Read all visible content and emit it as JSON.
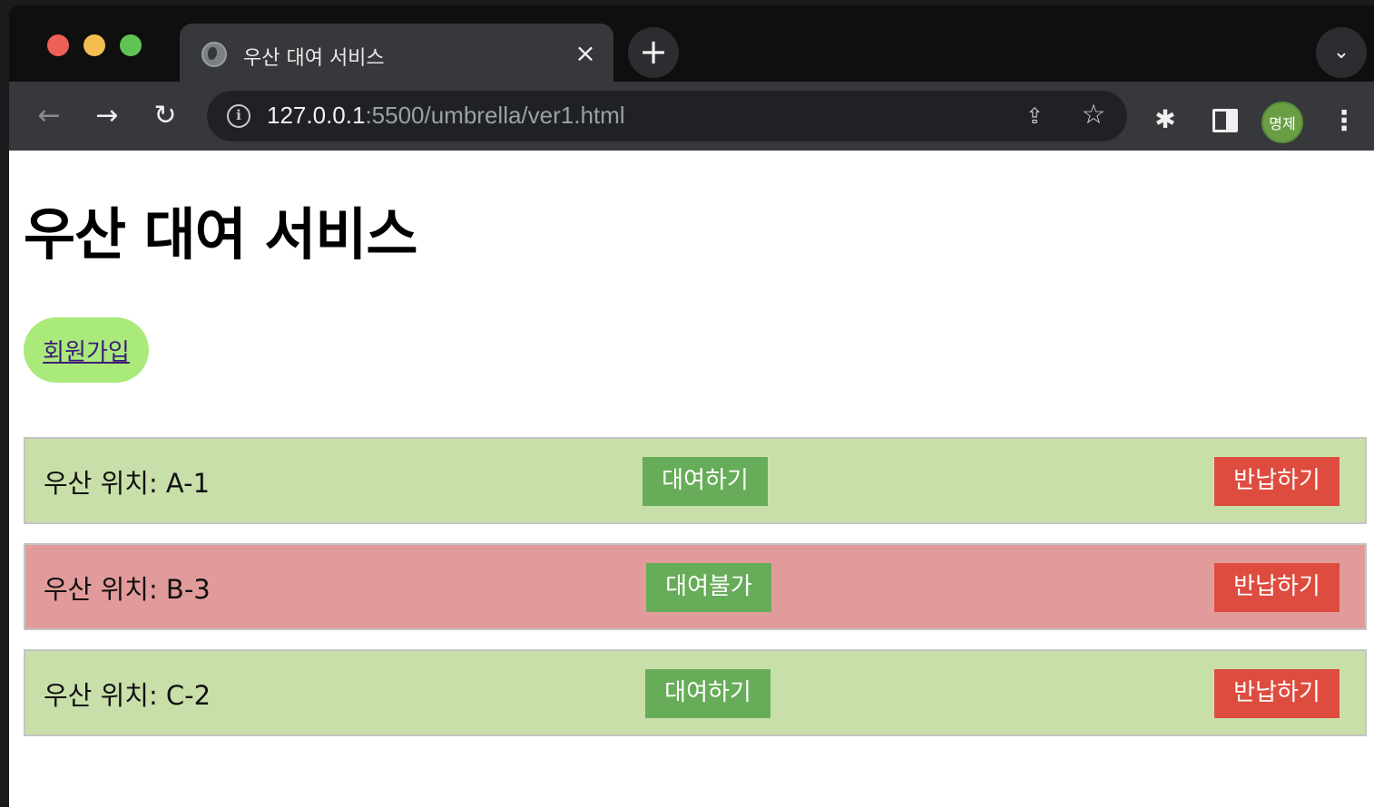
{
  "browser": {
    "tab_title": "우산 대여 서비스",
    "tab_close": "×",
    "new_tab": "+",
    "tab_menu": "⌄",
    "url_host": "127.0.0.1",
    "url_rest": ":5500/umbrella/ver1.html",
    "profile_initials": "명제",
    "icons": {
      "back": "back-arrow-icon",
      "forward": "forward-arrow-icon",
      "reload": "reload-icon",
      "info": "info-icon",
      "share": "share-icon",
      "bookmark": "star-icon",
      "extensions": "puzzle-icon",
      "side_panel": "side-panel-icon",
      "menu": "kebab-menu-icon"
    }
  },
  "page": {
    "title": "우산 대여 서비스",
    "signup_label": "회원가입",
    "umbrellas": [
      {
        "location": "우산 위치: A-1",
        "status": "available",
        "rent_label": "대여하기",
        "return_label": "반납하기"
      },
      {
        "location": "우산 위치: B-3",
        "status": "unavailable",
        "rent_label": "대여불가",
        "return_label": "반납하기"
      },
      {
        "location": "우산 위치: C-2",
        "status": "available",
        "rent_label": "대여하기",
        "return_label": "반납하기"
      }
    ]
  },
  "colors": {
    "available_bg": "#c9dfaa",
    "unavailable_bg": "#e29b9b",
    "rent_button": "#67ac58",
    "return_button": "#de4c3f",
    "signup_button": "#a9ea7a"
  }
}
